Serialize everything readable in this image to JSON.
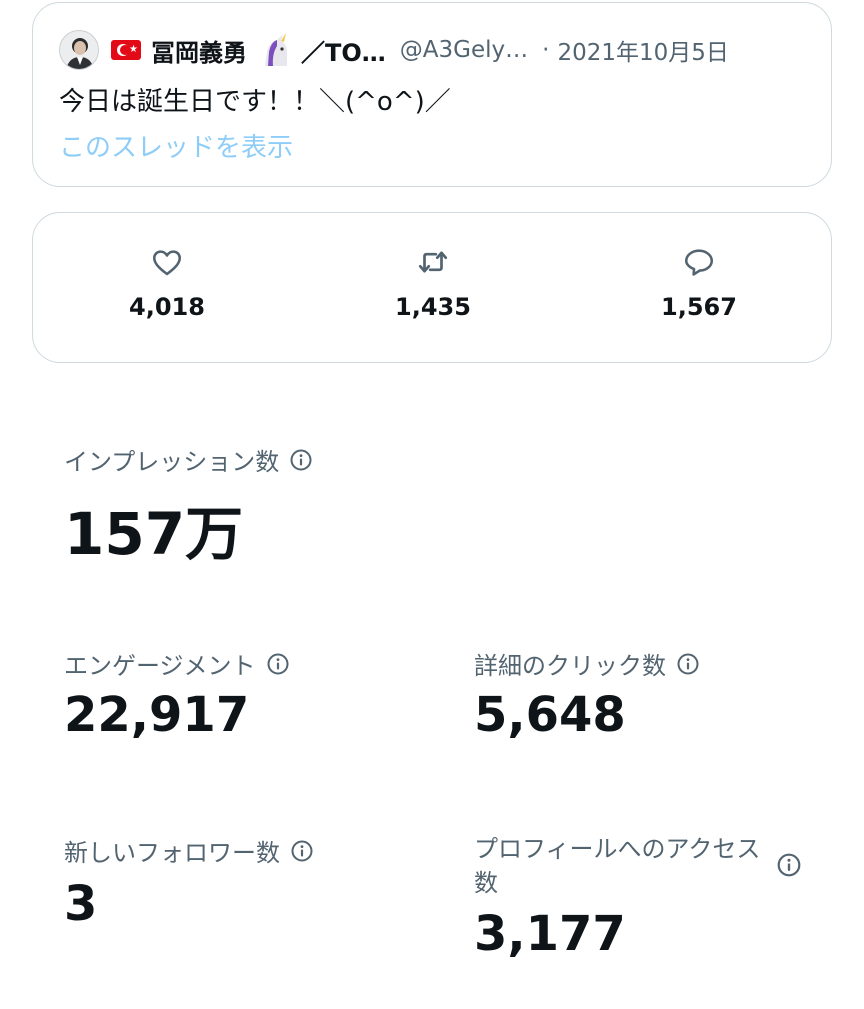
{
  "tweet": {
    "author_name": "冨岡義勇",
    "author_name_suffix": "／TO…",
    "handle": "@A3Gely…",
    "separator": "·",
    "date": "2021年10月5日",
    "text": "今日は誕生日です！！＼(^o^)／",
    "thread_link": "このスレッドを表示",
    "icons": [
      "avatar",
      "turkey-flag-icon",
      "unicorn-icon"
    ]
  },
  "engagement_counts": {
    "likes": "4,018",
    "retweets": "1,435",
    "replies": "1,567",
    "icons": [
      "heart-icon",
      "retweet-icon",
      "reply-icon"
    ]
  },
  "metrics": {
    "impressions": {
      "label": "インプレッション数",
      "value": "157万"
    },
    "engagements": {
      "label": "エンゲージメント",
      "value": "22,917"
    },
    "detail_clicks": {
      "label": "詳細のクリック数",
      "value": "5,648"
    },
    "new_followers": {
      "label": "新しいフォロワー数",
      "value": "3"
    },
    "profile_visits": {
      "label": "プロフィールへのアクセス数",
      "value": "3,177"
    }
  },
  "colors": {
    "text_primary": "#0f1419",
    "text_secondary": "#536471",
    "link": "#8ecdf8",
    "border": "#cfd9de",
    "flag_red": "#e30a17"
  }
}
